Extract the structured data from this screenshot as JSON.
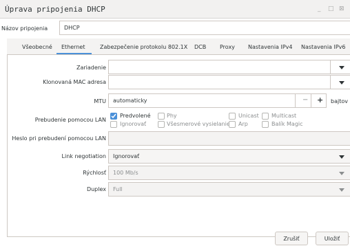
{
  "window": {
    "title": "Úprava pripojenia DHCP",
    "controls": {
      "minimize": "_",
      "maximize": "□",
      "close": "⊠"
    }
  },
  "connection": {
    "name_label": "Názov pripojenia",
    "name_value": "DHCP"
  },
  "tabs": [
    {
      "label": "Všeobecné",
      "active": false
    },
    {
      "label": "Ethernet",
      "active": true
    },
    {
      "label": "Zabezpečenie protokolu 802.1X",
      "active": false
    },
    {
      "label": "DCB",
      "active": false
    },
    {
      "label": "Proxy",
      "active": false
    },
    {
      "label": "Nastavenia IPv4",
      "active": false
    },
    {
      "label": "Nastavenia IPv6",
      "active": false
    }
  ],
  "ethernet": {
    "device": {
      "label": "Zariadenie",
      "value": ""
    },
    "cloned_mac": {
      "label": "Klonovaná MAC adresa",
      "value": ""
    },
    "mtu": {
      "label": "MTU",
      "value": "automaticky",
      "minus": "−",
      "plus": "+",
      "unit": "bajtov"
    },
    "wol": {
      "label": "Prebudenie pomocou LAN",
      "options": [
        {
          "label": "Predvolené",
          "checked": true
        },
        {
          "label": "Phy",
          "checked": false
        },
        {
          "label": "Unicast",
          "checked": false
        },
        {
          "label": "Multicast",
          "checked": false
        },
        {
          "label": "Ignorovať",
          "checked": false
        },
        {
          "label": "Všesmerové vysielanie",
          "checked": false
        },
        {
          "label": "Arp",
          "checked": false
        },
        {
          "label": "Balík Magic",
          "checked": false
        }
      ]
    },
    "wol_password": {
      "label": "Heslo pri prebudení pomocou LAN",
      "value": ""
    },
    "link_negotiation": {
      "label": "Link negotiation",
      "value": "Ignorovať"
    },
    "speed": {
      "label": "Rýchlosť",
      "value": "100 Mb/s"
    },
    "duplex": {
      "label": "Duplex",
      "value": "Full"
    }
  },
  "buttons": {
    "cancel": "Zrušiť",
    "save": "Uložiť"
  },
  "colors": {
    "accent": "#4a90d9",
    "text": "#2e3436",
    "disabled_text": "#8b8e8f",
    "border": "#cdc7c2"
  }
}
